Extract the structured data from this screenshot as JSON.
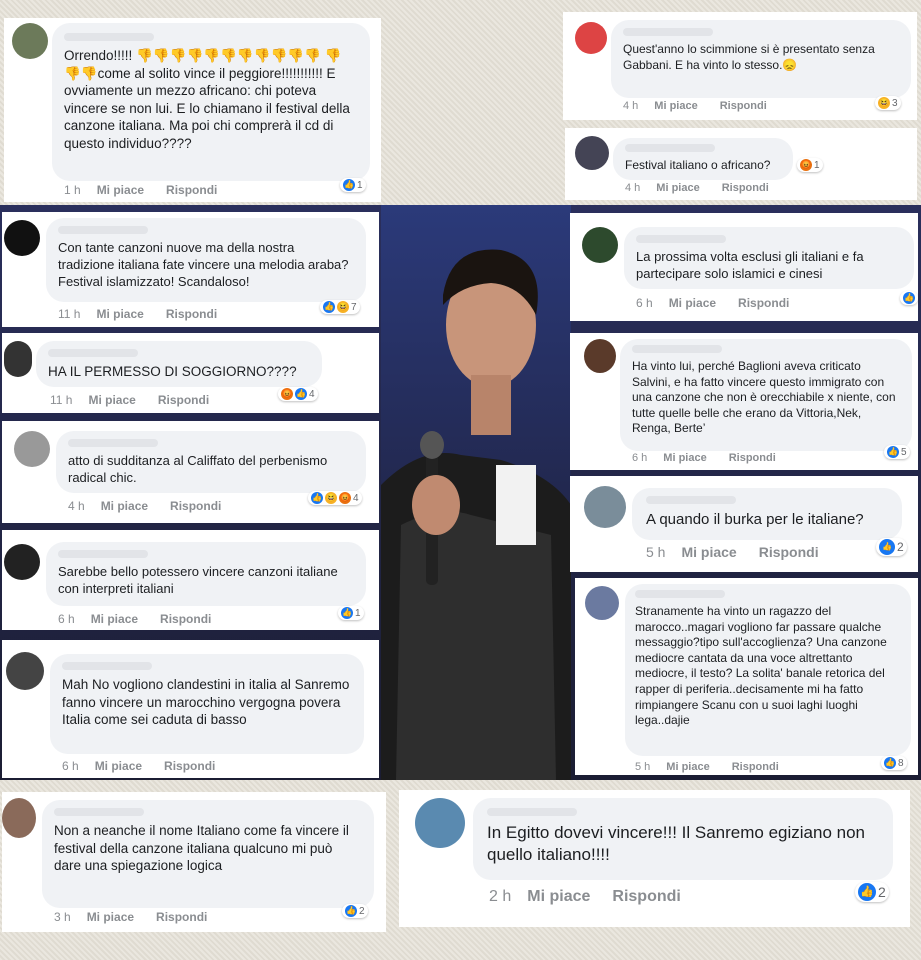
{
  "comments": [
    {
      "text": "Orrendo!!!!! 👎👎👎👎👎👎👎👎👎👎👎 👎👎👎come al solito vince il peggiore!!!!!!!!!!! E ovviamente un mezzo africano: chi poteva vincere se non lui. E lo chiamano il festival della canzone italiana. Ma poi chi comprerà il cd di questo individuo????",
      "time": "1 h",
      "like": "Mi piace",
      "reply": "Rispondi",
      "count": "1"
    },
    {
      "text": "Quest'anno lo scimmione si è presentato senza Gabbani. E ha vinto lo stesso.😞",
      "time": "4 h",
      "like": "Mi piace",
      "reply": "Rispondi",
      "count": "3"
    },
    {
      "text": "Festival italiano o africano?",
      "time": "4 h",
      "like": "Mi piace",
      "reply": "Rispondi",
      "count": "1"
    },
    {
      "text": "Con tante canzoni nuove ma della nostra tradizione italiana fate vincere una melodia araba? Festival islamizzato! Scandaloso!",
      "time": "11 h",
      "like": "Mi piace",
      "reply": "Rispondi",
      "count": "7"
    },
    {
      "text": "La prossima volta esclusi gli italiani e fa partecipare solo islamici e cinesi",
      "time": "6 h",
      "like": "Mi piace",
      "reply": "Rispondi",
      "count": ""
    },
    {
      "text": "HA IL PERMESSO DI SOGGIORNO????",
      "time": "11 h",
      "like": "Mi piace",
      "reply": "Rispondi",
      "count": "4"
    },
    {
      "text": "Ha vinto lui, perché Baglioni aveva criticato Salvini, e ha fatto vincere questo immigrato con una canzone che non è orecchiabile x niente, con tutte quelle belle che erano da Vittoria,Nek, Renga, Berte’",
      "time": "6 h",
      "like": "Mi piace",
      "reply": "Rispondi",
      "count": "5"
    },
    {
      "text": "atto di sudditanza al Califfato del perbenismo radical chic.",
      "time": "4 h",
      "like": "Mi piace",
      "reply": "Rispondi",
      "count": "4"
    },
    {
      "text": "A quando il burka per le italiane?",
      "time": "5 h",
      "like": "Mi piace",
      "reply": "Rispondi",
      "count": "2"
    },
    {
      "text": "Sarebbe bello potessero vincere canzoni italiane con interpreti italiani",
      "time": "6 h",
      "like": "Mi piace",
      "reply": "Rispondi",
      "count": "1"
    },
    {
      "text": "Stranamente ha vinto un ragazzo del marocco..magari vogliono far passare qualche messaggio?tipo sull'accoglienza? Una canzone mediocre cantata da una voce altrettanto mediocre, il testo? La solita' banale retorica del rapper di periferia..decisamente mi ha fatto rimpiangere Scanu con u suoi laghi luoghi lega..dajie",
      "time": "5 h",
      "like": "Mi piace",
      "reply": "Rispondi",
      "count": "8"
    },
    {
      "text": "Mah No vogliono clandestini in italia al Sanremo fanno vincere un marocchino vergogna povera Italia come sei caduta di basso",
      "time": "6 h",
      "like": "Mi piace",
      "reply": "Rispondi",
      "count": ""
    },
    {
      "text": "Non a neanche il nome Italiano  come fa vincere il festival  della canzone italiana qualcuno  mi può dare una spiegazione logica",
      "time": "3 h",
      "like": "Mi piace",
      "reply": "Rispondi",
      "count": "2"
    },
    {
      "text": "In Egitto dovevi vincere!!! Il Sanremo egiziano non quello italiano!!!!",
      "time": "2 h",
      "like": "Mi piace",
      "reply": "Rispondi",
      "count": "2"
    }
  ]
}
